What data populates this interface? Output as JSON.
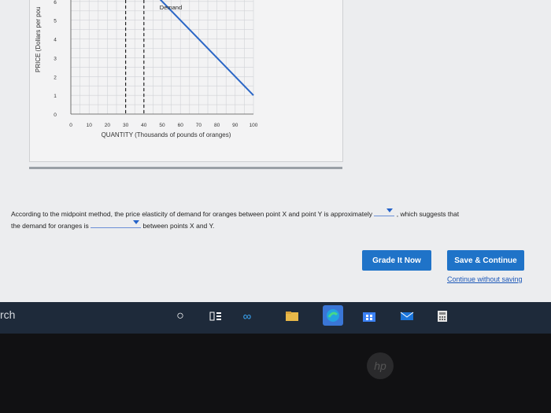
{
  "chart_data": {
    "type": "line",
    "title": "",
    "ylabel": "PRICE (Dollars per pou",
    "xlabel": "QUANTITY (Thousands of pounds of oranges)",
    "xlim": [
      0,
      100
    ],
    "ylim": [
      0,
      7
    ],
    "x_ticks": [
      "0",
      "10",
      "20",
      "30",
      "40",
      "50",
      "60",
      "70",
      "80",
      "90",
      "100"
    ],
    "y_ticks": [
      "0",
      "1",
      "2",
      "3",
      "4",
      "5",
      "6"
    ],
    "series": [
      {
        "name": "Demand",
        "points": [
          [
            40,
            7
          ],
          [
            100,
            1
          ]
        ]
      }
    ],
    "vertical_dashed_lines": [
      30,
      40
    ]
  },
  "question": {
    "text1": "According to the midpoint method, the price elasticity of demand for oranges between point X and point Y is approximately",
    "text2": ", which suggests that",
    "text3": "the demand for oranges is",
    "text4": "between points X and Y."
  },
  "buttons": {
    "grade": "Grade It Now",
    "save": "Save & Continue",
    "continue": "Continue without saving"
  },
  "taskbar": {
    "search_text": "rch",
    "icons": [
      "circle-search-icon",
      "task-view-icon",
      "infinity-app-icon",
      "file-explorer-icon",
      "edge-browser-icon",
      "store-icon",
      "mail-icon",
      "calculator-icon"
    ]
  },
  "colors": {
    "demand_line": "#2a66c6",
    "button": "#1f73c8",
    "taskbar": "#1e2a3a"
  },
  "logo": "hp"
}
